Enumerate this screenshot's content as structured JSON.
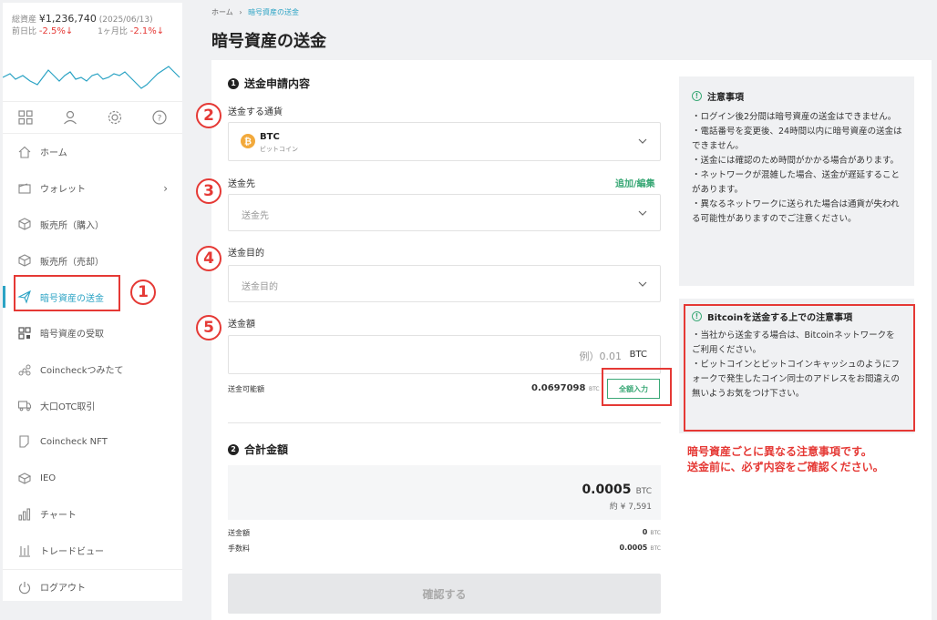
{
  "summary": {
    "total_label": "総資産",
    "total_value": "¥1,236,740",
    "date": "(2025/06/13)",
    "day_label": "前日比",
    "day_value": "-2.5%↓",
    "month_label": "1ヶ月比",
    "month_value": "-2.1%↓"
  },
  "sidebar": {
    "items": [
      {
        "label": "ホーム",
        "icon": "home-icon"
      },
      {
        "label": "ウォレット",
        "icon": "wallet-icon"
      },
      {
        "label": "販売所（購入）",
        "icon": "cube-icon"
      },
      {
        "label": "販売所（売却）",
        "icon": "cube-icon"
      },
      {
        "label": "暗号資産の送金",
        "icon": "send-icon"
      },
      {
        "label": "暗号資産の受取",
        "icon": "qr-icon"
      },
      {
        "label": "Coincheckつみたて",
        "icon": "coins-icon"
      },
      {
        "label": "大口OTC取引",
        "icon": "truck-icon"
      },
      {
        "label": "Coincheck NFT",
        "icon": "card-icon"
      },
      {
        "label": "IEO",
        "icon": "box-icon"
      },
      {
        "label": "チャート",
        "icon": "chart-icon"
      },
      {
        "label": "トレードビュー",
        "icon": "tradeview-icon"
      }
    ],
    "logout": "ログアウト"
  },
  "breadcrumb": {
    "home": "ホーム",
    "sep": "›",
    "current": "暗号資産の送金"
  },
  "page_title": "暗号資産の送金",
  "form": {
    "section1_num": "1",
    "section1_title": "送金申請内容",
    "currency_label": "送金する通貨",
    "currency_code": "BTC",
    "currency_name": "ビットコイン",
    "dest_label": "送金先",
    "dest_link": "追加/編集",
    "dest_placeholder": "送金先",
    "purpose_label": "送金目的",
    "purpose_placeholder": "送金目的",
    "amount_label": "送金額",
    "amount_placeholder": "例）0.01",
    "amount_unit": "BTC",
    "available_label": "送金可能額",
    "available_value": "0.0697098",
    "available_unit": "BTC",
    "fill_all_button": "全額入力",
    "section2_num": "2",
    "section2_title": "合計金額",
    "total_value": "0.0005",
    "total_unit": "BTC",
    "total_jpy": "約 ¥ 7,591",
    "send_amount_label": "送金額",
    "send_amount_value": "0",
    "send_amount_unit": "BTC",
    "fee_label": "手数料",
    "fee_value": "0.0005",
    "fee_unit": "BTC",
    "confirm_button": "確認する"
  },
  "notice1": {
    "title": "注意事項",
    "lines": [
      "・ログイン後2分間は暗号資産の送金はできません。",
      "・電話番号を変更後、24時間以内に暗号資産の送金はできません。",
      "・送金には確認のため時間がかかる場合があります。",
      "・ネットワークが混雑した場合、送金が遅延することがあります。",
      "・異なるネットワークに送られた場合は通貨が失われる可能性がありますのでご注意ください。"
    ]
  },
  "notice2": {
    "title": "Bitcoinを送金する上での注意事項",
    "lines": [
      "・当社から送金する場合は、Bitcoinネットワークをご利用ください。",
      "・ビットコインとビットコインキャッシュのようにフォークで発生したコイン同士のアドレスをお間違えの無いようお気をつけ下さい。"
    ]
  },
  "annotations": {
    "n1": "1",
    "n2": "2",
    "n3": "3",
    "n4": "4",
    "n5": "5",
    "red_note_1": "暗号資産ごとに異なる注意事項です。",
    "red_note_2": "送金前に、必ず内容をご確認ください。"
  },
  "colors": {
    "accent": "#2ba3c4",
    "green": "#3aa876",
    "red": "#e53935",
    "bitcoin": "#f2a93b"
  }
}
